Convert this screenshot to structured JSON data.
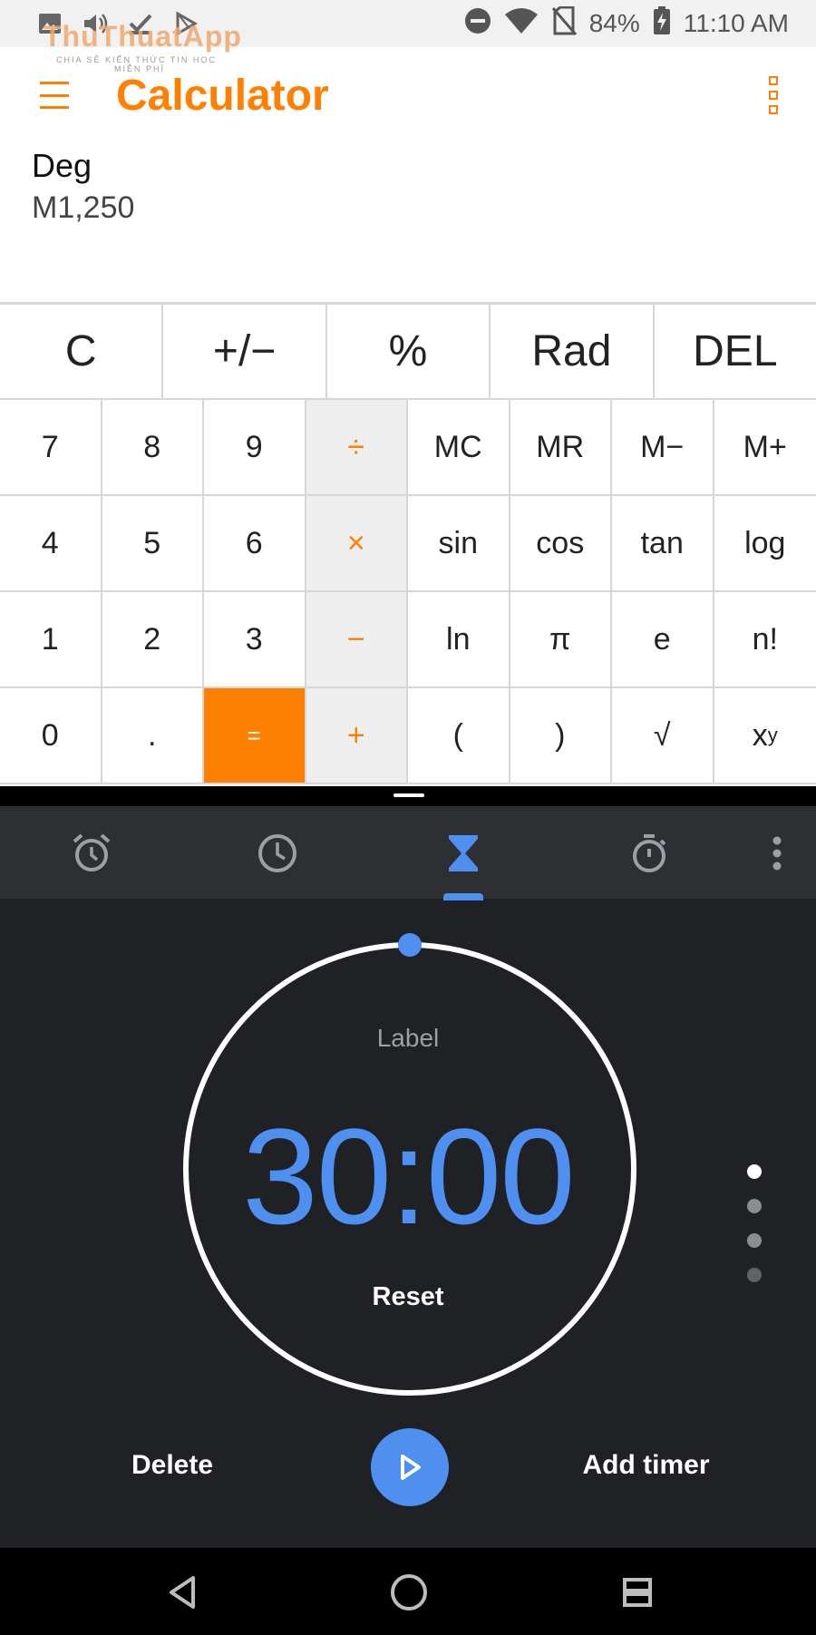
{
  "status_bar": {
    "battery": "84%",
    "time": "11:10 AM",
    "icons": [
      "image-icon",
      "volume-icon",
      "checkbox-icon",
      "play-store-icon",
      "do-not-disturb-icon",
      "wifi-icon",
      "no-sim-icon",
      "battery-charging-icon"
    ]
  },
  "watermark": {
    "title": "ThuThuatApp",
    "subtitle": "CHIA SẺ KIẾN THỨC TIN HỌC",
    "subtitle2": "MIỄN PHÍ"
  },
  "calculator": {
    "title": "Calculator",
    "mode": "Deg",
    "memory": "M1,250",
    "top_row": [
      "C",
      "+/−",
      "%",
      "Rad",
      "DEL"
    ],
    "rows": [
      [
        "7",
        "8",
        "9",
        "÷",
        "MC",
        "MR",
        "M−",
        "M+"
      ],
      [
        "4",
        "5",
        "6",
        "×",
        "sin",
        "cos",
        "tan",
        "log"
      ],
      [
        "1",
        "2",
        "3",
        "−",
        "ln",
        "π",
        "e",
        "n!"
      ],
      [
        "0",
        ".",
        "=",
        "+",
        "(",
        ")",
        "√",
        "x"
      ]
    ],
    "power_sup": "y",
    "accent": "#ff7f00"
  },
  "clock": {
    "tabs": [
      "alarm-icon",
      "clock-icon",
      "timer-icon",
      "stopwatch-icon"
    ],
    "active_tab": "timer-icon",
    "label": "Label",
    "time": "30:00",
    "reset": "Reset",
    "delete": "Delete",
    "add_timer": "Add timer",
    "accent": "#4e8ff0",
    "background": "#202124"
  }
}
